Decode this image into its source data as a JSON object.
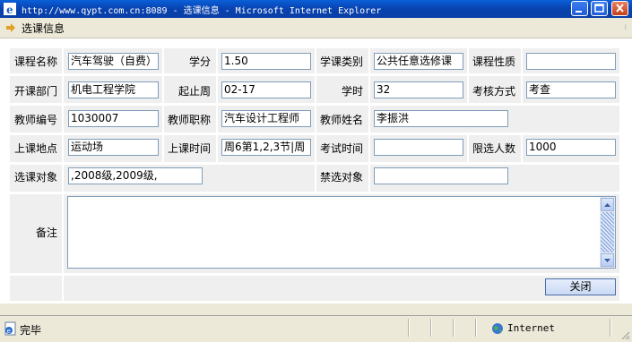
{
  "window": {
    "title": "http://www.qypt.com.cn:8089 - 选课信息 - Microsoft Internet Explorer"
  },
  "toolbar": {
    "title": "选课信息"
  },
  "form": {
    "course_name_label": "课程名称",
    "course_name_value": "汽车驾驶（自费）",
    "credit_label": "学分",
    "credit_value": "1.50",
    "category_label": "学课类别",
    "category_value": "公共任意选修课",
    "nature_label": "课程性质",
    "nature_value": "",
    "dept_label": "开课部门",
    "dept_value": "机电工程学院",
    "weeks_label": "起止周",
    "weeks_value": "02-17",
    "hours_label": "学时",
    "hours_value": "32",
    "assess_label": "考核方式",
    "assess_value": "考查",
    "teacher_id_label": "教师编号",
    "teacher_id_value": "1030007",
    "teacher_title_label": "教师职称",
    "teacher_title_value": "汽车设计工程师",
    "teacher_name_label": "教师姓名",
    "teacher_name_value": "李振洪",
    "place_label": "上课地点",
    "place_value": "运动场",
    "time_label": "上课时间",
    "time_value": "周6第1,2,3节|周",
    "exam_label": "考试时间",
    "exam_value": "",
    "limit_label": "限选人数",
    "limit_value": "1000",
    "target_label": "选课对象",
    "target_value": ",2008级,2009级,",
    "banned_label": "禁选对象",
    "banned_value": "",
    "remark_label": "备注",
    "remark_value": "",
    "close_label": "关闭"
  },
  "status": {
    "text": "完毕",
    "zone": "Internet"
  }
}
